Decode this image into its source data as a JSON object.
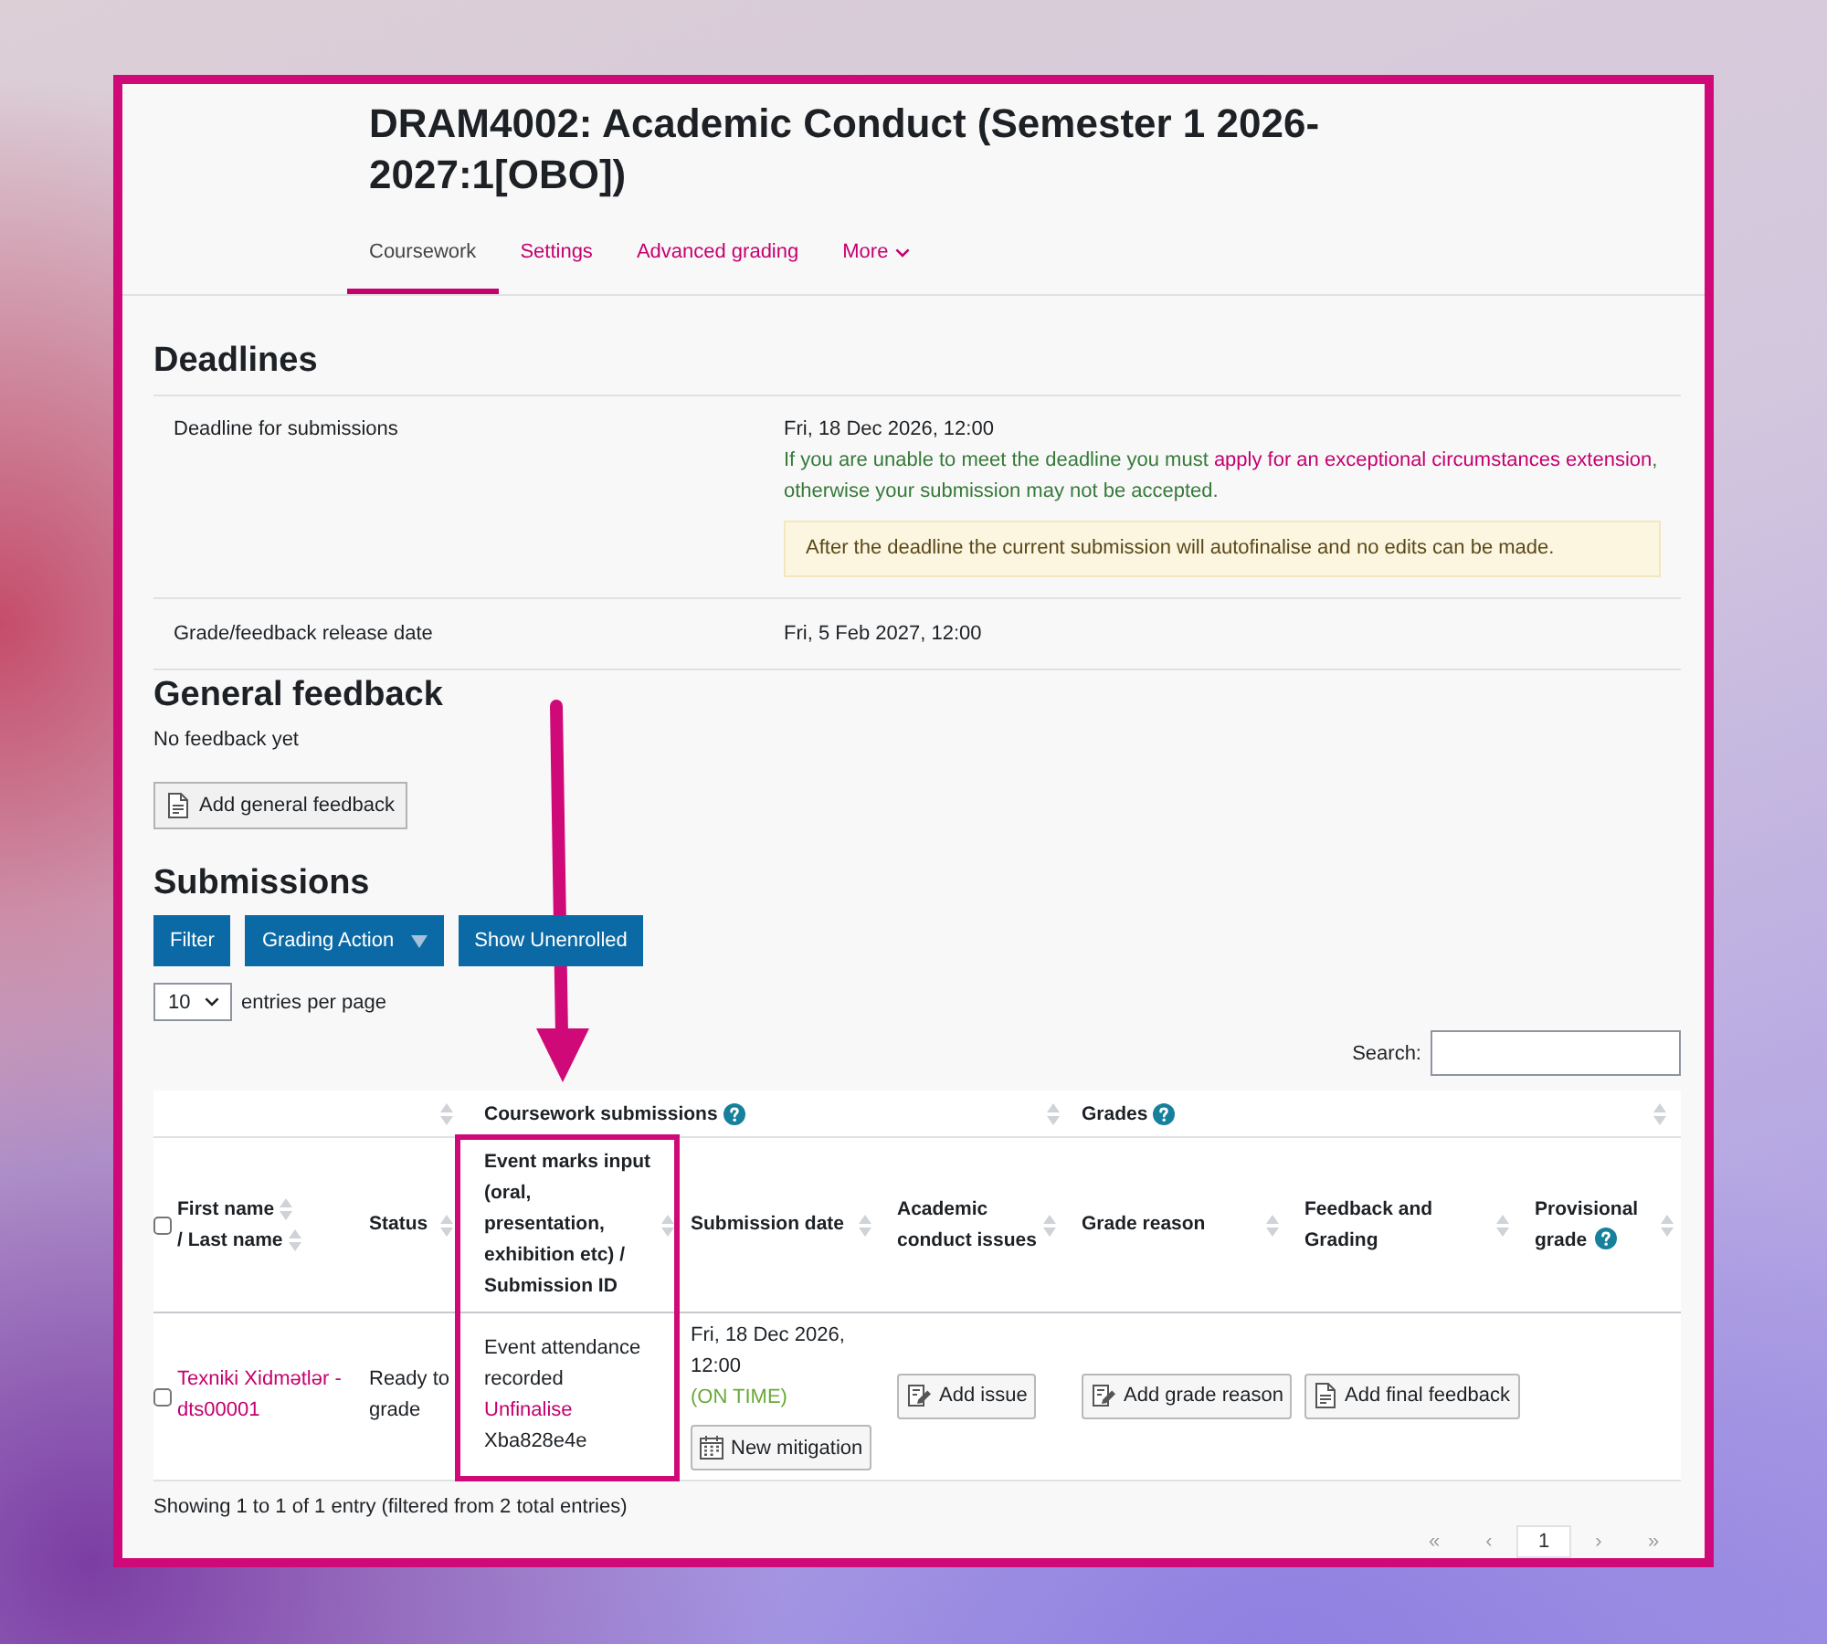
{
  "page": {
    "title": "DRAM4002: Academic Conduct (Semester 1 2026-2027:1[OBO])"
  },
  "tabs": [
    {
      "label": "Coursework",
      "selected": true,
      "kind": "link"
    },
    {
      "label": "Settings",
      "selected": false,
      "kind": "link"
    },
    {
      "label": "Advanced grading",
      "selected": false,
      "kind": "link"
    },
    {
      "label": "More",
      "selected": false,
      "kind": "menu"
    }
  ],
  "deadlines": {
    "heading": "Deadlines",
    "rows": [
      {
        "label": "Deadline for submissions",
        "value": "Fri, 18 Dec 2026, 12:00",
        "note": {
          "before": "If you are unable to meet the deadline you must ",
          "link": "apply for an exceptional circumstances extension",
          "after": ", otherwise your submission may not be accepted."
        },
        "alert": "After the deadline the current submission will autofinalise and no edits can be made."
      },
      {
        "label": "Grade/feedback release date",
        "value": "Fri, 5 Feb 2027, 12:00"
      }
    ]
  },
  "general_feedback": {
    "heading": "General feedback",
    "text": "No feedback yet",
    "button": "Add general feedback"
  },
  "submissions": {
    "heading": "Submissions",
    "buttons": [
      {
        "label": "Filter",
        "kind": "plain"
      },
      {
        "label": "Grading Action",
        "kind": "dropdown"
      },
      {
        "label": "Show Unenrolled",
        "kind": "plain"
      }
    ],
    "page_size": {
      "value": "10",
      "label": "entries per page"
    },
    "search": {
      "label": "Search:"
    },
    "table": {
      "column_groups": [
        {
          "sortable": true,
          "help": false,
          "columns": [
            {
              "kind": "select",
              "checked": false
            },
            {
              "kind": "names",
              "labels": [
                "First name",
                "/ Last name"
              ],
              "sortable": true,
              "highlighted": false
            },
            {
              "kind": "text",
              "label": "Status",
              "sortable": true,
              "help": false,
              "highlighted": false
            }
          ]
        },
        {
          "label": "Coursework submissions",
          "sortable": true,
          "help": true,
          "columns": [
            {
              "kind": "text",
              "label": "Event marks input (oral, presentation, exhibition etc) / Submission ID",
              "sortable": true,
              "help": false,
              "highlighted": true
            },
            {
              "kind": "text",
              "label": "Submission date",
              "sortable": true,
              "help": false,
              "highlighted": false
            },
            {
              "kind": "text",
              "label": "Academic conduct issues",
              "sortable": true,
              "help": false,
              "highlighted": false
            }
          ]
        },
        {
          "label": "Grades",
          "sortable": true,
          "help": true,
          "columns": [
            {
              "kind": "text",
              "label": "Grade reason",
              "sortable": true,
              "help": false,
              "highlighted": false
            },
            {
              "kind": "text",
              "label": "Feedback and Grading",
              "sortable": true,
              "help": false,
              "highlighted": false
            },
            {
              "kind": "text",
              "label": "Provisional grade",
              "sortable": true,
              "help": true,
              "highlighted": false
            }
          ]
        }
      ],
      "rows": [
        {
          "checked": false,
          "cells": [
            {
              "parts": [
                {
                  "kind": "link",
                  "text": "Texniki Xidmətlər - dts00001"
                }
              ]
            },
            {
              "parts": [
                {
                  "kind": "text",
                  "text": "Ready to grade"
                }
              ]
            },
            {
              "parts": [
                {
                  "kind": "text",
                  "text": "Event attendance recorded"
                },
                {
                  "kind": "link",
                  "text": "Unfinalise"
                },
                {
                  "kind": "text",
                  "text": "Xba828e4e"
                }
              ]
            },
            {
              "parts": [
                {
                  "kind": "text",
                  "text": "Fri, 18 Dec 2026, 12:00"
                },
                {
                  "kind": "status",
                  "text": "(ON TIME)"
                },
                {
                  "kind": "button",
                  "text": "New mitigation"
                }
              ]
            },
            {
              "parts": [
                {
                  "kind": "button",
                  "text": "Add issue"
                }
              ]
            },
            {
              "parts": [
                {
                  "kind": "button",
                  "text": "Add grade reason"
                }
              ]
            },
            {
              "parts": [
                {
                  "kind": "button",
                  "text": "Add final feedback"
                }
              ]
            }
          ]
        }
      ]
    },
    "info": "Showing 1 to 1 of 1 entry (filtered from 2 total entries)",
    "pagination": [
      {
        "label": "«",
        "selected": false
      },
      {
        "label": "‹",
        "selected": false
      },
      {
        "label": "1",
        "selected": true
      },
      {
        "label": "›",
        "selected": false
      },
      {
        "label": "»",
        "selected": false
      }
    ]
  }
}
